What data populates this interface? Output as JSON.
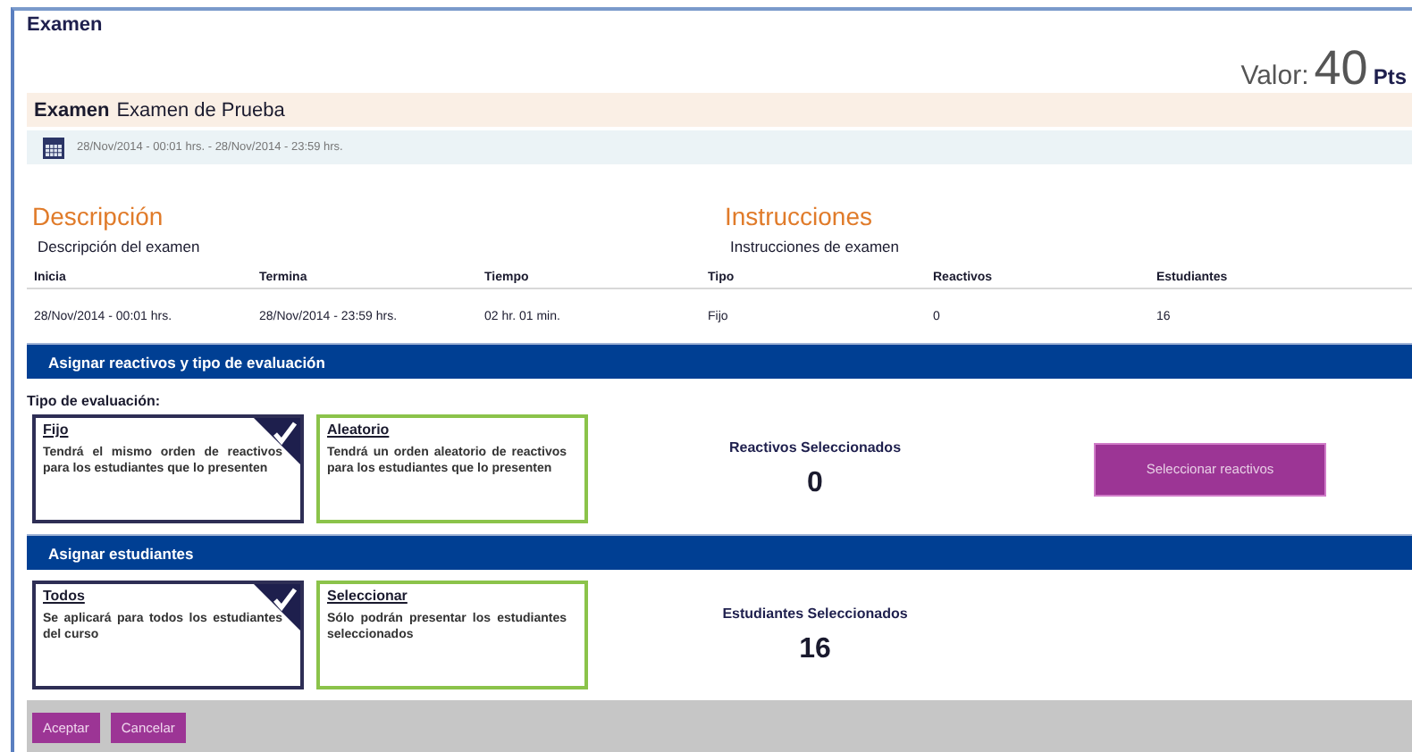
{
  "window": {
    "title": "Examen"
  },
  "value": {
    "label": "Valor:",
    "number": "40",
    "unit": "Pts"
  },
  "exam": {
    "label": "Examen",
    "name": "Examen de Prueba",
    "dates": "28/Nov/2014 - 00:01 hrs. - 28/Nov/2014 - 23:59 hrs."
  },
  "description": {
    "heading": "Descripción",
    "text": "Descripción del examen"
  },
  "instructions": {
    "heading": "Instrucciones",
    "text": "Instrucciones de examen"
  },
  "table": {
    "columns": [
      "Inicia",
      "Termina",
      "Tiempo",
      "Tipo",
      "Reactivos",
      "Estudiantes"
    ],
    "rows": [
      [
        "28/Nov/2014 - 00:01 hrs.",
        "28/Nov/2014 - 23:59 hrs.",
        "02 hr. 01 min.",
        "Fijo",
        "0",
        "16"
      ]
    ]
  },
  "sections": [
    {
      "title": "Asignar reactivos y tipo de evaluación",
      "subtitle": "Tipo de evaluación:",
      "options": [
        {
          "title": "Fijo",
          "text": "Tendrá el mismo orden de reactivos para los estudiantes que lo presenten",
          "selected": true
        },
        {
          "title": "Aleatorio",
          "text": "Tendrá un orden aleatorio de reactivos para los estudiantes que lo presenten",
          "selected": false
        }
      ],
      "counter_label": "Reactivos Seleccionados",
      "counter": "0",
      "button": "Seleccionar reactivos"
    },
    {
      "title": "Asignar estudiantes",
      "options": [
        {
          "title": "Todos",
          "text": "Se aplicará para todos los estudiantes del curso",
          "selected": true
        },
        {
          "title": "Seleccionar",
          "text": "Sólo podrán presentar los estudiantes seleccionados",
          "selected": false
        }
      ],
      "counter_label": "Estudiantes Seleccionados",
      "counter": "16"
    }
  ],
  "buttons": [
    "Aceptar",
    "Cancelar"
  ]
}
